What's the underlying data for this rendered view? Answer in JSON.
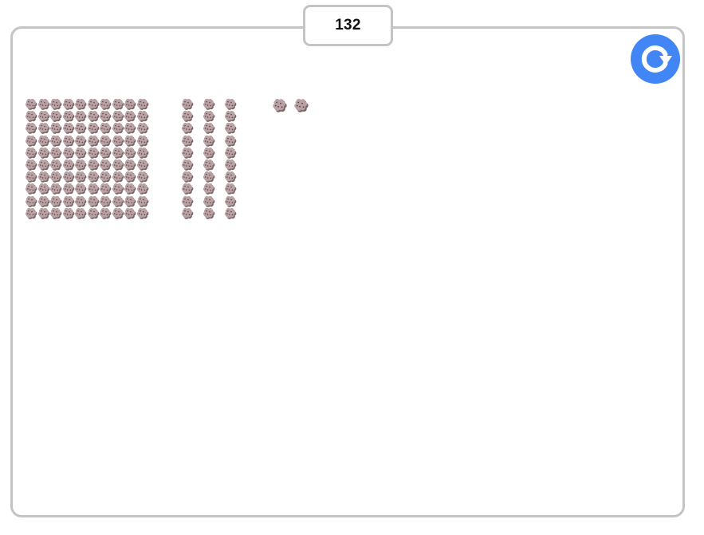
{
  "counter": {
    "value": "132"
  },
  "reset_button": {
    "icon": "rotate-clockwise-icon",
    "color": "#4285f4"
  },
  "manipulatives": {
    "item_icon": "cookie-icon",
    "cookie_color": "#b9a2a4",
    "cookie_shadow": "#7b6768",
    "chip_color": "#5a3f3f",
    "hundreds": 1,
    "tens": 3,
    "ones": 2
  }
}
